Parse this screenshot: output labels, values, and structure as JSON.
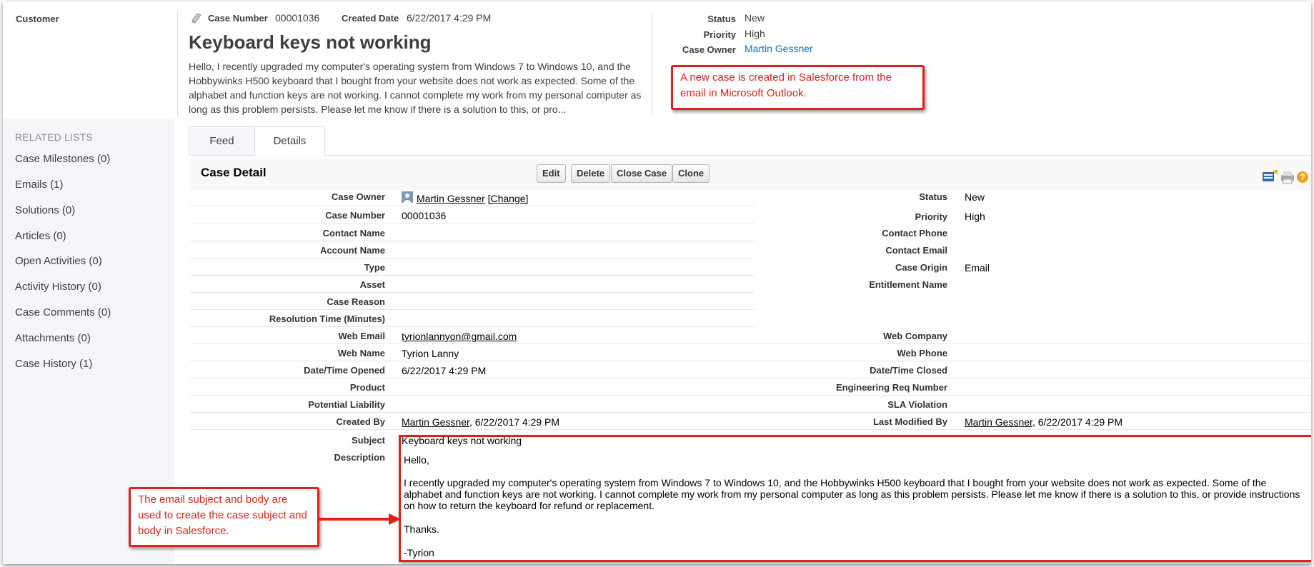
{
  "customer": {
    "label": "Customer"
  },
  "header": {
    "case_number_label": "Case Number",
    "case_number_value": "00001036",
    "created_date_label": "Created Date",
    "created_date_value": "6/22/2017 4:29 PM",
    "title": "Keyboard keys not working",
    "description_preview": "Hello, I recently upgraded my computer's operating system from Windows 7 to Windows 10, and the Hobbywinks H500 keyboard that I bought from your website does not work as expected. Some of the alphabet and function keys are not working. I cannot complete my work from my personal computer as long as this problem persists. Please let me know if there is a solution to this, or pro...",
    "status_label": "Status",
    "status_value": "New",
    "priority_label": "Priority",
    "priority_value": "High",
    "owner_label": "Case Owner",
    "owner_value": "Martin Gessner"
  },
  "callouts": {
    "top": "A new case is created in Salesforce from the email in Microsoft Outlook.",
    "bottom": "The email subject and body are used to create the case subject and body in Salesforce."
  },
  "related_lists": {
    "title": "RELATED LISTS",
    "items": [
      "Case Milestones (0)",
      "Emails (1)",
      "Solutions (0)",
      "Articles (0)",
      "Open Activities (0)",
      "Activity History (0)",
      "Case Comments (0)",
      "Attachments (0)",
      "Case History (1)"
    ]
  },
  "tabs": {
    "feed": "Feed",
    "details": "Details"
  },
  "detail": {
    "title": "Case Detail",
    "buttons": {
      "edit": "Edit",
      "delete": "Delete",
      "close_case": "Close Case",
      "clone": "Clone"
    },
    "left_fields": [
      {
        "label": "Case Owner",
        "value": "Martin Gessner",
        "extra": "[Change]"
      },
      {
        "label": "Case Number",
        "value": "00001036"
      },
      {
        "label": "Contact Name",
        "value": ""
      },
      {
        "label": "Account Name",
        "value": ""
      },
      {
        "label": "Type",
        "value": ""
      },
      {
        "label": "Asset",
        "value": ""
      },
      {
        "label": "Case Reason",
        "value": ""
      },
      {
        "label": "Resolution Time (Minutes)",
        "value": ""
      },
      {
        "label": "Web Email",
        "value": "tyrionlannyon@gmail.com"
      },
      {
        "label": "Web Name",
        "value": "Tyrion Lanny"
      },
      {
        "label": "Date/Time Opened",
        "value": "6/22/2017 4:29 PM"
      },
      {
        "label": "Product",
        "value": ""
      },
      {
        "label": "Potential Liability",
        "value": ""
      },
      {
        "label": "Created By",
        "value": "Martin Gessner",
        "extra": ", 6/22/2017 4:29 PM"
      },
      {
        "label": "Subject",
        "value": "Keyboard keys not working"
      },
      {
        "label": "Description",
        "value": ""
      }
    ],
    "right_fields": [
      {
        "label": "Status",
        "value": "New"
      },
      {
        "label": "Priority",
        "value": "High"
      },
      {
        "label": "Contact Phone",
        "value": ""
      },
      {
        "label": "Contact Email",
        "value": ""
      },
      {
        "label": "Case Origin",
        "value": "Email"
      },
      {
        "label": "Entitlement Name",
        "value": ""
      },
      {
        "label": "Web Company",
        "value": ""
      },
      {
        "label": "Web Phone",
        "value": ""
      },
      {
        "label": "Date/Time Closed",
        "value": ""
      },
      {
        "label": "Engineering Req Number",
        "value": ""
      },
      {
        "label": "SLA Violation",
        "value": ""
      },
      {
        "label": "Last Modified By",
        "value": "Martin Gessner",
        "extra": ", 6/22/2017 4:29 PM"
      }
    ],
    "description": {
      "greeting": "Hello,",
      "body": "I recently upgraded my computer's operating system from Windows 7 to Windows 10, and the Hobbywinks H500 keyboard that I bought from your website does not work as expected. Some of the alphabet and function keys are not working. I cannot complete my work from my personal computer as long as this problem persists. Please let me know if there is a solution to this, or provide instructions on how to return the keyboard for refund or replacement.",
      "thanks": "Thanks.",
      "signature": "-Tyrion"
    }
  },
  "colors": {
    "link": "#0070d2",
    "annotation": "#e0201a",
    "sidebar_bg": "#f4f6f9"
  }
}
